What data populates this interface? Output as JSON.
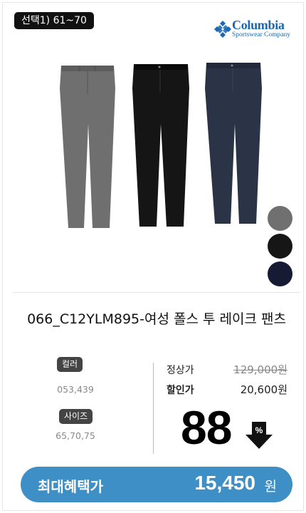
{
  "badge": {
    "label": "선택1) 61~70"
  },
  "brand": {
    "name": "Columbia",
    "subtitle": "Sportswear Company",
    "color": "#1b67b3"
  },
  "product": {
    "title": "066_C12YLM895-여성 폴스 투 레이크 팬츠",
    "image_icon": "pants-product-image",
    "variant_colors": [
      "#6f6f6f",
      "#151515",
      "#2b3347"
    ]
  },
  "swatches": [
    "#707070",
    "#161616",
    "#161b33"
  ],
  "options": {
    "color_label": "컬러",
    "color_value": "053,439",
    "size_label": "사이즈",
    "size_value": "65,70,75"
  },
  "price": {
    "regular_label": "정상가",
    "regular_value": "129,000원",
    "sale_label": "할인가",
    "sale_value": "20,600원",
    "discount_number": "88",
    "discount_symbol": "%"
  },
  "cta": {
    "label": "최대혜택가",
    "price": "15,450",
    "unit": "원",
    "color": "#3f8fc7"
  }
}
